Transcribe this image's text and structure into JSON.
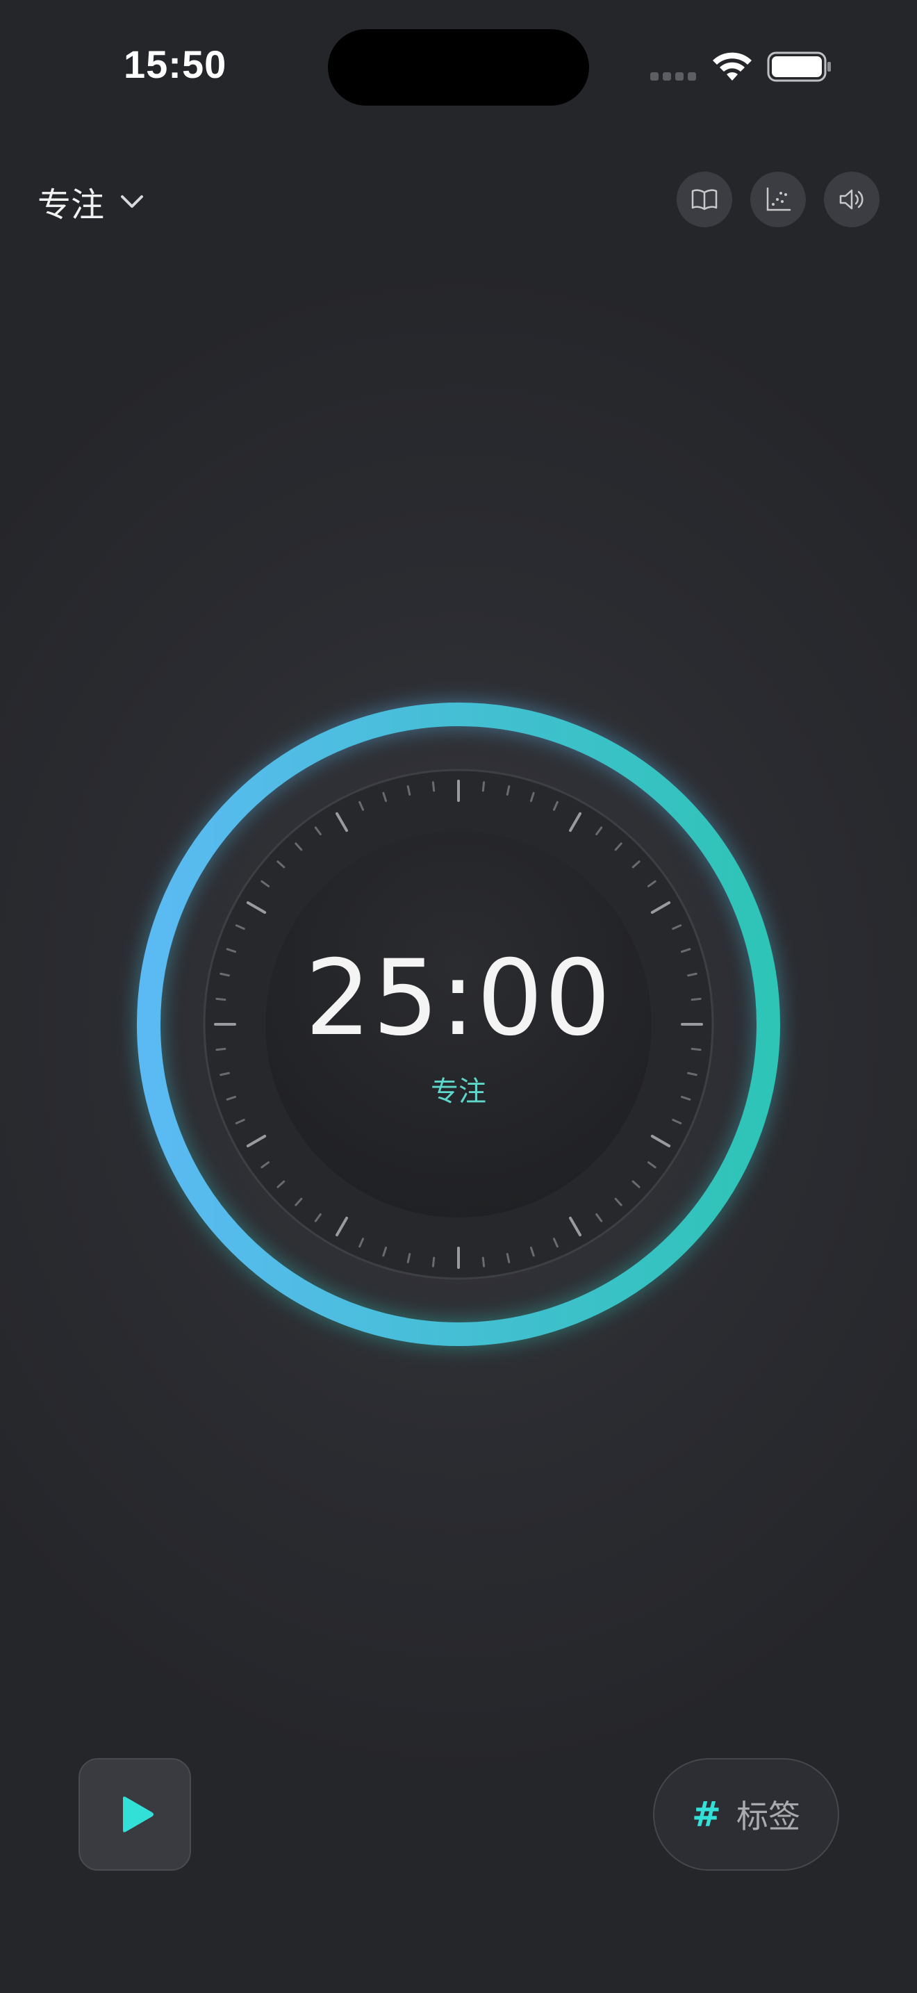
{
  "status_bar": {
    "time": "15:50"
  },
  "header": {
    "mode_label": "专注",
    "actions": [
      {
        "icon": "book-icon"
      },
      {
        "icon": "chart-icon"
      },
      {
        "icon": "speaker-icon"
      }
    ]
  },
  "timer": {
    "time": "25:00",
    "mode": "专注",
    "progress": 1.0
  },
  "controls": {
    "play_icon": "play-icon",
    "tag_icon": "#",
    "tag_label": "标签"
  },
  "colors": {
    "ring_top": "#5bbaf3",
    "ring_bottom": "#2ec4b6",
    "accent": "#33e0d8",
    "mode_text": "#5ed6c9",
    "background": "#2b2c31"
  }
}
